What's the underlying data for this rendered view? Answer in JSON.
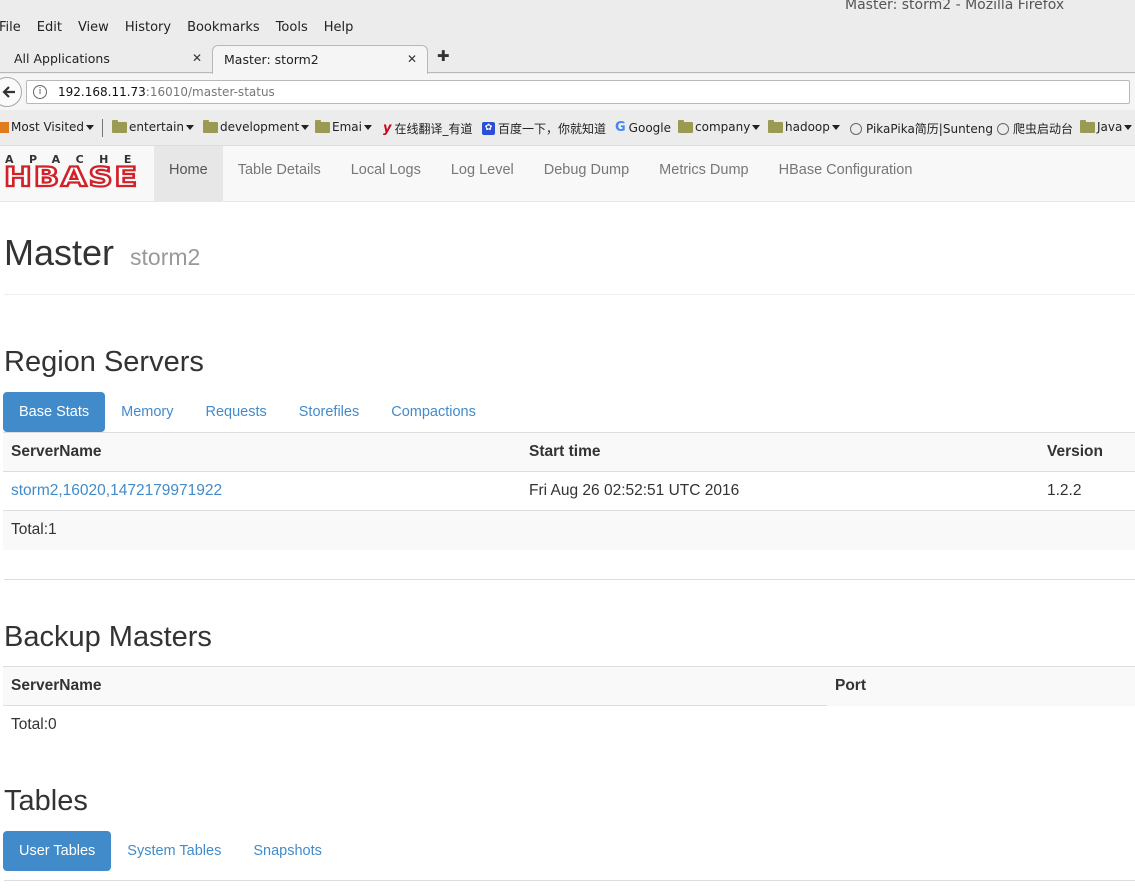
{
  "browser": {
    "window_title": "Master: storm2 - Mozilla Firefox",
    "menu": [
      "File",
      "Edit",
      "View",
      "History",
      "Bookmarks",
      "Tools",
      "Help"
    ],
    "tabs": [
      {
        "label": "All Applications"
      },
      {
        "label": "Master: storm2"
      }
    ],
    "url_host": "192.168.11.73",
    "url_rest": ":16010/master-status",
    "bookmarks": {
      "most_visited": "Most Visited",
      "entertain": "entertain",
      "development": "development",
      "emai": "Emai",
      "youdao": "在线翻译_有道",
      "baidu": "百度一下，你就知道",
      "google": "Google",
      "company": "company",
      "hadoop": "hadoop",
      "pikapika": "PikaPika简历|Sunteng",
      "spider": "爬虫启动台",
      "java": "Java"
    }
  },
  "hbase": {
    "logo_top": "APACHE",
    "logo_bottom": "HBASE",
    "nav": [
      "Home",
      "Table Details",
      "Local Logs",
      "Log Level",
      "Debug Dump",
      "Metrics Dump",
      "HBase Configuration"
    ]
  },
  "header": {
    "title": "Master",
    "subtitle": "storm2"
  },
  "region_servers": {
    "heading": "Region Servers",
    "tabs": [
      "Base Stats",
      "Memory",
      "Requests",
      "Storefiles",
      "Compactions"
    ],
    "columns": [
      "ServerName",
      "Start time",
      "Version"
    ],
    "rows": [
      {
        "server": "storm2,16020,1472179971922",
        "start": "Fri Aug 26 02:52:51 UTC 2016",
        "version": "1.2.2"
      }
    ],
    "total": "Total:1"
  },
  "backup_masters": {
    "heading": "Backup Masters",
    "columns": [
      "ServerName",
      "Port"
    ],
    "total": "Total:0"
  },
  "tables": {
    "heading": "Tables",
    "tabs": [
      "User Tables",
      "System Tables",
      "Snapshots"
    ]
  },
  "colors": {
    "accent": "#428bca",
    "logo_red": "#d22128"
  }
}
